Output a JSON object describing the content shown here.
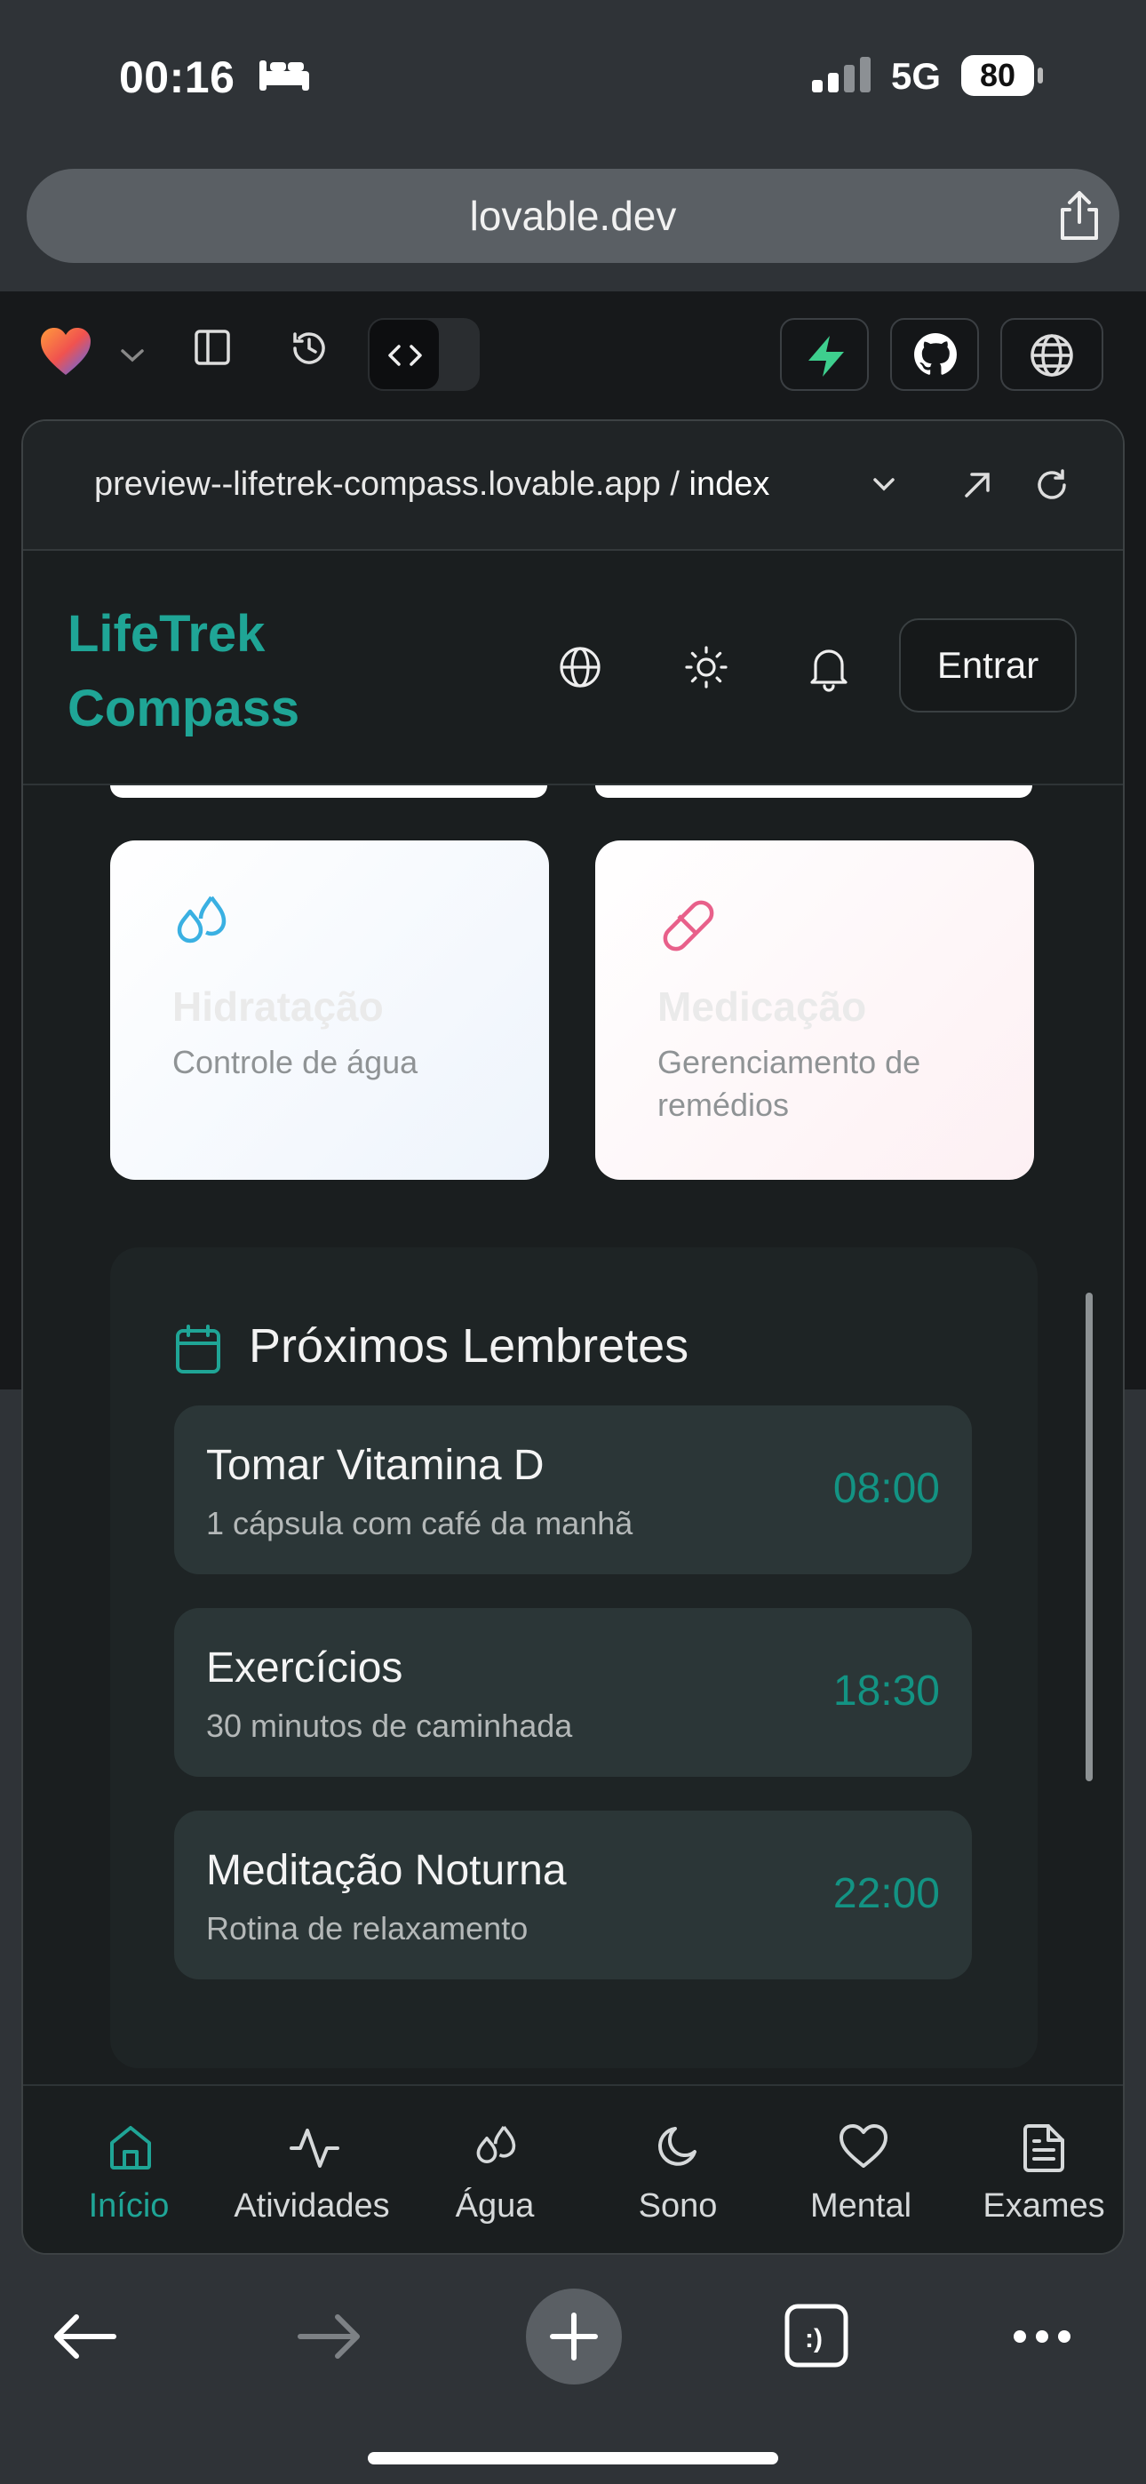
{
  "status_bar": {
    "time": "00:16",
    "network": "5G",
    "battery": "80"
  },
  "browser": {
    "url": "lovable.dev"
  },
  "preview": {
    "address": "preview--lifetrek-compass.lovable.app / ",
    "page": "index"
  },
  "app": {
    "brand_line1": "LifeTrek",
    "brand_line2": "Compass",
    "login_label": "Entrar"
  },
  "cards": [
    {
      "title": "Hidratação",
      "subtitle": "Controle de água",
      "icon": "droplets-icon",
      "color": "#3ab0e2"
    },
    {
      "title": "Medicação",
      "subtitle": "Gerenciamento de remédios",
      "icon": "pill-icon",
      "color": "#e8608a"
    }
  ],
  "reminders": {
    "title": "Próximos Lembretes",
    "items": [
      {
        "title": "Tomar Vitamina D",
        "subtitle": "1 cápsula com café da manhã",
        "time": "08:00"
      },
      {
        "title": "Exercícios",
        "subtitle": "30 minutos de caminhada",
        "time": "18:30"
      },
      {
        "title": "Meditação Noturna",
        "subtitle": "Rotina de relaxamento",
        "time": "22:00"
      }
    ]
  },
  "nav": [
    {
      "label": "Início",
      "icon": "home-icon",
      "active": true
    },
    {
      "label": "Atividades",
      "icon": "activity-icon",
      "active": false
    },
    {
      "label": "Água",
      "icon": "droplets-icon",
      "active": false
    },
    {
      "label": "Sono",
      "icon": "moon-icon",
      "active": false
    },
    {
      "label": "Mental",
      "icon": "heart-icon",
      "active": false
    },
    {
      "label": "Exames",
      "icon": "file-text-icon",
      "active": false
    }
  ],
  "colors": {
    "accent": "#1fa596",
    "time_accent": "#139383",
    "background": "#1a1e1f"
  }
}
